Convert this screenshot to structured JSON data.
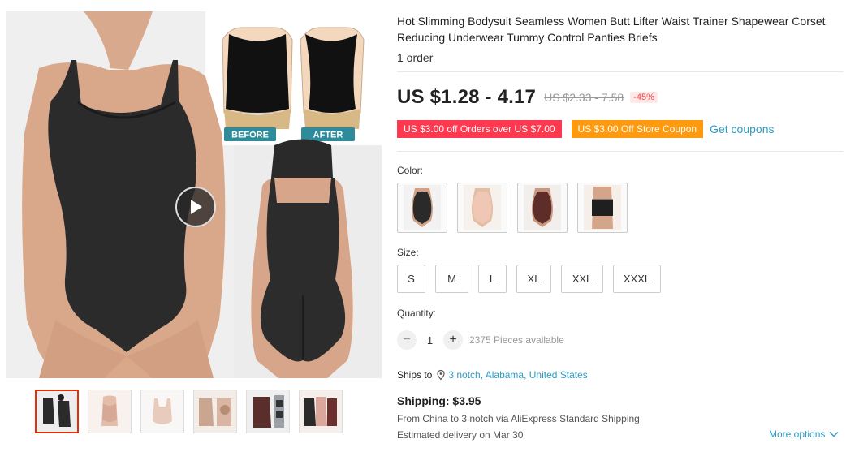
{
  "product": {
    "title": "Hot Slimming Bodysuit Seamless Women Butt Lifter Waist Trainer Shapewear Corset Reducing Underwear Tummy Control Panties Briefs",
    "orders": "1 order",
    "price": "US $1.28 - 4.17",
    "original_price": "US $2.33 - 7.58",
    "discount": "-45%"
  },
  "gallery": {
    "before_label": "BEFORE",
    "after_label": "AFTER",
    "thumbnails": [
      "thumb-1",
      "thumb-2",
      "thumb-3",
      "thumb-4",
      "thumb-5",
      "thumb-6"
    ],
    "active_thumbnail": 0
  },
  "coupons": {
    "coupon1": "US $3.00 off Orders over US $7.00",
    "coupon2": "US $3.00 Off Store Coupon",
    "get_coupons": "Get coupons"
  },
  "color": {
    "label": "Color:",
    "options": [
      "black",
      "beige",
      "brown",
      "waist-trainer"
    ]
  },
  "size": {
    "label": "Size:",
    "options": [
      "S",
      "M",
      "L",
      "XL",
      "XXL",
      "XXXL"
    ]
  },
  "quantity": {
    "label": "Quantity:",
    "minus": "−",
    "plus": "+",
    "value": "1",
    "available": "2375 Pieces available"
  },
  "shipping": {
    "ships_to_label": "Ships to",
    "location": "3 notch, Alabama, United States",
    "title": "Shipping: $3.95",
    "route": "From China to 3 notch via AliExpress Standard Shipping",
    "delivery": "Estimated delivery on Mar 30",
    "more_options": "More options"
  },
  "colors": {
    "price_red": "#fd384f",
    "coupon_orange": "#ff9a0e",
    "link_blue": "#2e9cc3",
    "active_thumb_border": "#e62e04"
  }
}
